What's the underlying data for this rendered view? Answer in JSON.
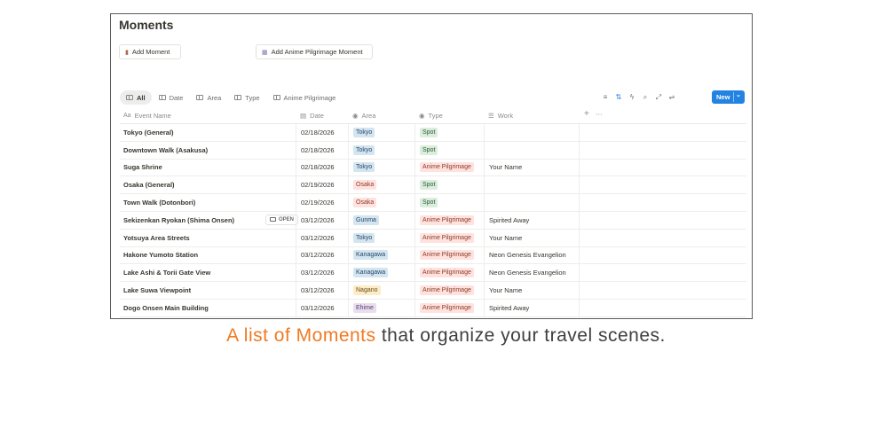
{
  "page": {
    "title": "Moments",
    "buttons": [
      {
        "label": "Add Moment",
        "icon": "note-icon"
      },
      {
        "label": "Add Anime Pilgrimage Moment",
        "icon": "film-icon"
      }
    ]
  },
  "views": [
    "All",
    "Date",
    "Area",
    "Type",
    "Anime Pilgrimage"
  ],
  "toolbar": {
    "icons": [
      "filter-icon",
      "sort-icon",
      "automation-icon",
      "search-icon",
      "expand-icon",
      "settings-icon"
    ],
    "new_label": "New"
  },
  "columns": {
    "name": "Event Name",
    "date": "Date",
    "area": "Area",
    "type": "Type",
    "work": "Work"
  },
  "open_label": "OPEN",
  "rows": [
    {
      "name": "Tokyo (General)",
      "date": "02/18/2026",
      "area": "Tokyo",
      "type": "Spot",
      "work": ""
    },
    {
      "name": "Downtown Walk (Asakusa)",
      "date": "02/18/2026",
      "area": "Tokyo",
      "type": "Spot",
      "work": ""
    },
    {
      "name": "Suga Shrine",
      "date": "02/18/2026",
      "area": "Tokyo",
      "type": "Anime Pilgrimage",
      "work": "Your Name"
    },
    {
      "name": "Osaka (General)",
      "date": "02/19/2026",
      "area": "Osaka",
      "type": "Spot",
      "work": ""
    },
    {
      "name": "Town Walk (Dotonbori)",
      "date": "02/19/2026",
      "area": "Osaka",
      "type": "Spot",
      "work": ""
    },
    {
      "name": "Sekizenkan Ryokan (Shima Onsen)",
      "date": "03/12/2026",
      "area": "Gunma",
      "type": "Anime Pilgrimage",
      "work": "Spirited Away"
    },
    {
      "name": "Yotsuya Area Streets",
      "date": "03/12/2026",
      "area": "Tokyo",
      "type": "Anime Pilgrimage",
      "work": "Your Name"
    },
    {
      "name": "Hakone Yumoto Station",
      "date": "03/12/2026",
      "area": "Kanagawa",
      "type": "Anime Pilgrimage",
      "work": "Neon Genesis Evangelion"
    },
    {
      "name": "Lake Ashi & Torii Gate View",
      "date": "03/12/2026",
      "area": "Kanagawa",
      "type": "Anime Pilgrimage",
      "work": "Neon Genesis Evangelion"
    },
    {
      "name": "Lake Suwa Viewpoint",
      "date": "03/12/2026",
      "area": "Nagano",
      "type": "Anime Pilgrimage",
      "work": "Your Name"
    },
    {
      "name": "Dogo Onsen Main Building",
      "date": "03/12/2026",
      "area": "Ehime",
      "type": "Anime Pilgrimage",
      "work": "Spirited Away"
    }
  ],
  "tag_colors": {
    "Tokyo": {
      "bg": "#d3e5ef",
      "fg": "#28456c"
    },
    "Osaka": {
      "bg": "#ffe2dd",
      "fg": "#8b3a2a"
    },
    "Gunma": {
      "bg": "#d3e5ef",
      "fg": "#28456c"
    },
    "Kanagawa": {
      "bg": "#d3e5ef",
      "fg": "#28456c"
    },
    "Nagano": {
      "bg": "#fdecc8",
      "fg": "#6b4e16"
    },
    "Ehime": {
      "bg": "#e8deee",
      "fg": "#5a3a6e"
    },
    "Spot": {
      "bg": "#dbeddb",
      "fg": "#2b593f"
    },
    "Anime Pilgrimage": {
      "bg": "#ffe2dd",
      "fg": "#8b3a2a"
    }
  },
  "caption": {
    "accent": "A list of Moments",
    "rest": " that organize your travel scenes."
  }
}
